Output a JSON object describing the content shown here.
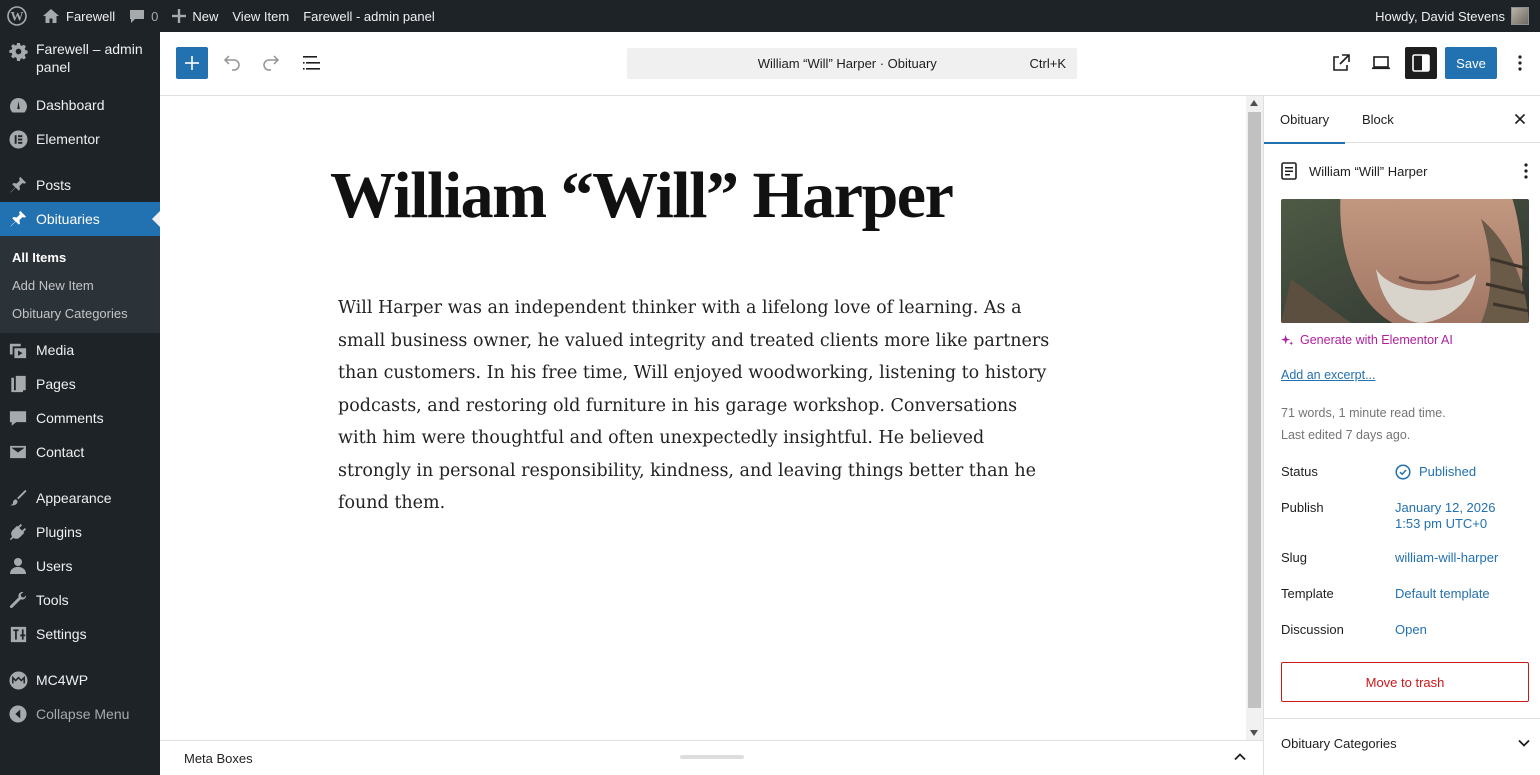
{
  "admin_bar": {
    "site_name": "Farewell",
    "comments_count": "0",
    "new_label": "New",
    "view_item_label": "View Item",
    "panel_label": "Farewell - admin panel",
    "howdy": "Howdy, David Stevens"
  },
  "sidebar": {
    "site_item": "Farewell – admin panel",
    "items": [
      {
        "label": "Dashboard",
        "icon": "dashboard-icon"
      },
      {
        "label": "Elementor",
        "icon": "elementor-icon"
      },
      {
        "label": "Posts",
        "icon": "pin-icon"
      },
      {
        "label": "Obituaries",
        "icon": "pin-icon"
      },
      {
        "label": "Media",
        "icon": "media-icon"
      },
      {
        "label": "Pages",
        "icon": "pages-icon"
      },
      {
        "label": "Comments",
        "icon": "comment-icon"
      },
      {
        "label": "Contact",
        "icon": "mail-icon"
      },
      {
        "label": "Appearance",
        "icon": "brush-icon"
      },
      {
        "label": "Plugins",
        "icon": "plug-icon"
      },
      {
        "label": "Users",
        "icon": "user-icon"
      },
      {
        "label": "Tools",
        "icon": "wrench-icon"
      },
      {
        "label": "Settings",
        "icon": "sliders-icon"
      },
      {
        "label": "MC4WP",
        "icon": "mc4wp-icon"
      },
      {
        "label": "Collapse Menu",
        "icon": "collapse-icon"
      }
    ],
    "submenu": [
      "All Items",
      "Add New Item",
      "Obituary Categories"
    ]
  },
  "header": {
    "doc_title": "William “Will” Harper · Obituary",
    "shortcut": "Ctrl+K",
    "save_label": "Save"
  },
  "post": {
    "title": "William “Will” Harper",
    "body": "Will Harper was an independent thinker with a lifelong love of learning. As a small business owner, he valued integrity and treated clients more like partners than customers. In his free time, Will enjoyed woodworking, listening to history podcasts, and restoring old furniture in his garage workshop. Conversations with him were thoughtful and often unexpectedly insightful. He believed strongly in personal responsibility, kindness, and leaving things better than he found them."
  },
  "settings": {
    "tab_obituary": "Obituary",
    "tab_block": "Block",
    "post_card_title": "William “Will” Harper",
    "generate_ai": "Generate with Elementor AI",
    "add_excerpt": "Add an excerpt...",
    "word_count": "71 words, 1 minute read time.",
    "last_edited": "Last edited 7 days ago.",
    "status_label": "Status",
    "status_value": "Published",
    "publish_label": "Publish",
    "publish_date": "January 12, 2026",
    "publish_time": "1:53 pm UTC+0",
    "slug_label": "Slug",
    "slug_value": "william-will-harper",
    "template_label": "Template",
    "template_value": "Default template",
    "discussion_label": "Discussion",
    "discussion_value": "Open",
    "trash_label": "Move to trash",
    "categories_label": "Obituary Categories"
  },
  "footer": {
    "meta_boxes": "Meta Boxes"
  },
  "colors": {
    "admin_dark": "#1d2327",
    "accent": "#2271b1",
    "danger": "#cc1818",
    "ai_magenta": "#b01f9f"
  }
}
